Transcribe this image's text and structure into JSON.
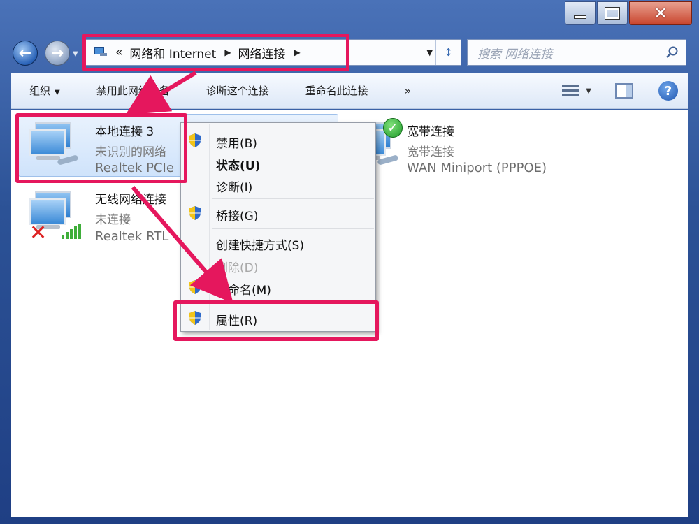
{
  "window": {
    "caption_buttons": [
      "minimize",
      "maximize",
      "close"
    ],
    "close_glyph": "✕"
  },
  "address_bar": {
    "crumb_prefix": "«",
    "crumbs": [
      "网络和 Internet",
      "网络连接"
    ],
    "separator": "▶",
    "dropdown_glyph": "▼",
    "refresh_glyph": "↕"
  },
  "search": {
    "placeholder": "搜索 网络连接"
  },
  "toolbar": {
    "organize": "组织",
    "disable_device": "禁用此网络设备",
    "diagnose": "诊断这个连接",
    "rename": "重命名此连接",
    "more": "»"
  },
  "connections": [
    {
      "name": "本地连接 3",
      "status": "未识别的网络",
      "device": "Realtek PCIe"
    },
    {
      "name": "无线网络连接",
      "status": "未连接",
      "device": "Realtek RTL"
    },
    {
      "name": "宽带连接",
      "status": "宽带连接",
      "device": "WAN Miniport (PPPOE)"
    }
  ],
  "context_menu": {
    "items": [
      {
        "label": "禁用(B)",
        "shield": true,
        "bold": false,
        "disabled": false
      },
      {
        "label": "状态(U)",
        "shield": false,
        "bold": true,
        "disabled": false
      },
      {
        "label": "诊断(I)",
        "shield": false,
        "bold": false,
        "disabled": false
      },
      {
        "label": "桥接(G)",
        "shield": true,
        "bold": false,
        "disabled": false
      },
      {
        "label": "创建快捷方式(S)",
        "shield": false,
        "bold": false,
        "disabled": false
      },
      {
        "label": "删除(D)",
        "shield": false,
        "bold": false,
        "disabled": true
      },
      {
        "label": "重命名(M)",
        "shield": true,
        "bold": false,
        "disabled": false
      },
      {
        "label": "属性(R)",
        "shield": true,
        "bold": false,
        "disabled": false
      }
    ]
  },
  "colors": {
    "highlight": "#e5175d",
    "window_frame": "#2c5296"
  }
}
